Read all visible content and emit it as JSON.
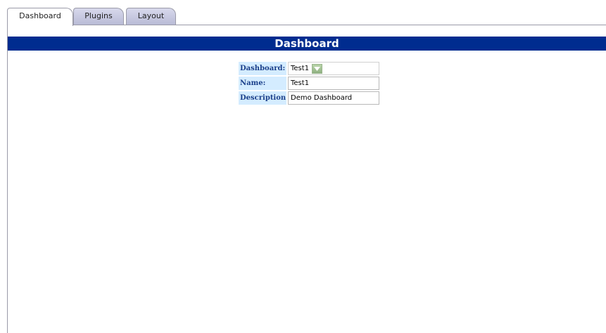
{
  "tabs": [
    {
      "label": "Dashboard",
      "active": true
    },
    {
      "label": "Plugins",
      "active": false
    },
    {
      "label": "Layout",
      "active": false
    }
  ],
  "page": {
    "title": "Dashboard"
  },
  "form": {
    "dashboard_label": "Dashboard:",
    "dashboard_value": "Test1",
    "name_label": "Name:",
    "name_value": "Test1",
    "description_label": "Description:",
    "description_value": "Demo Dashboard"
  },
  "colors": {
    "title_bar": "#002c8f",
    "label_bg": "#d4ecff",
    "label_text": "#1a3f8a",
    "inactive_tab": "#c4c6de"
  },
  "icons": {
    "select_dropdown": "chevron-down-icon"
  }
}
